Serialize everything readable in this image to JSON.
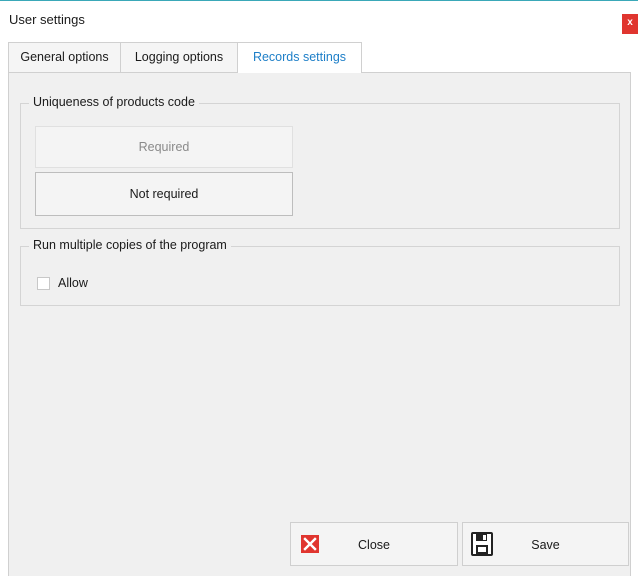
{
  "window": {
    "title": "User settings",
    "close_glyph": "x"
  },
  "tabs": [
    {
      "label": "General options",
      "active": false
    },
    {
      "label": "Logging options",
      "active": false
    },
    {
      "label": "Records settings",
      "active": true
    }
  ],
  "uniqueness_group": {
    "title": "Uniqueness of products code",
    "required_label": "Required",
    "not_required_label": "Not required"
  },
  "multiple_copies_group": {
    "title": "Run multiple copies of the program",
    "allow_label": "Allow",
    "allow_checked": false
  },
  "actions": {
    "close_label": "Close",
    "save_label": "Save"
  },
  "colors": {
    "accent_tab_text": "#1e7fc8",
    "close_red": "#e0352f",
    "title_border": "#3aa8b8"
  },
  "icons": {
    "close_button_icon": "red-x-icon",
    "save_button_icon": "floppy-disk-icon",
    "window_close_icon": "close-icon"
  }
}
